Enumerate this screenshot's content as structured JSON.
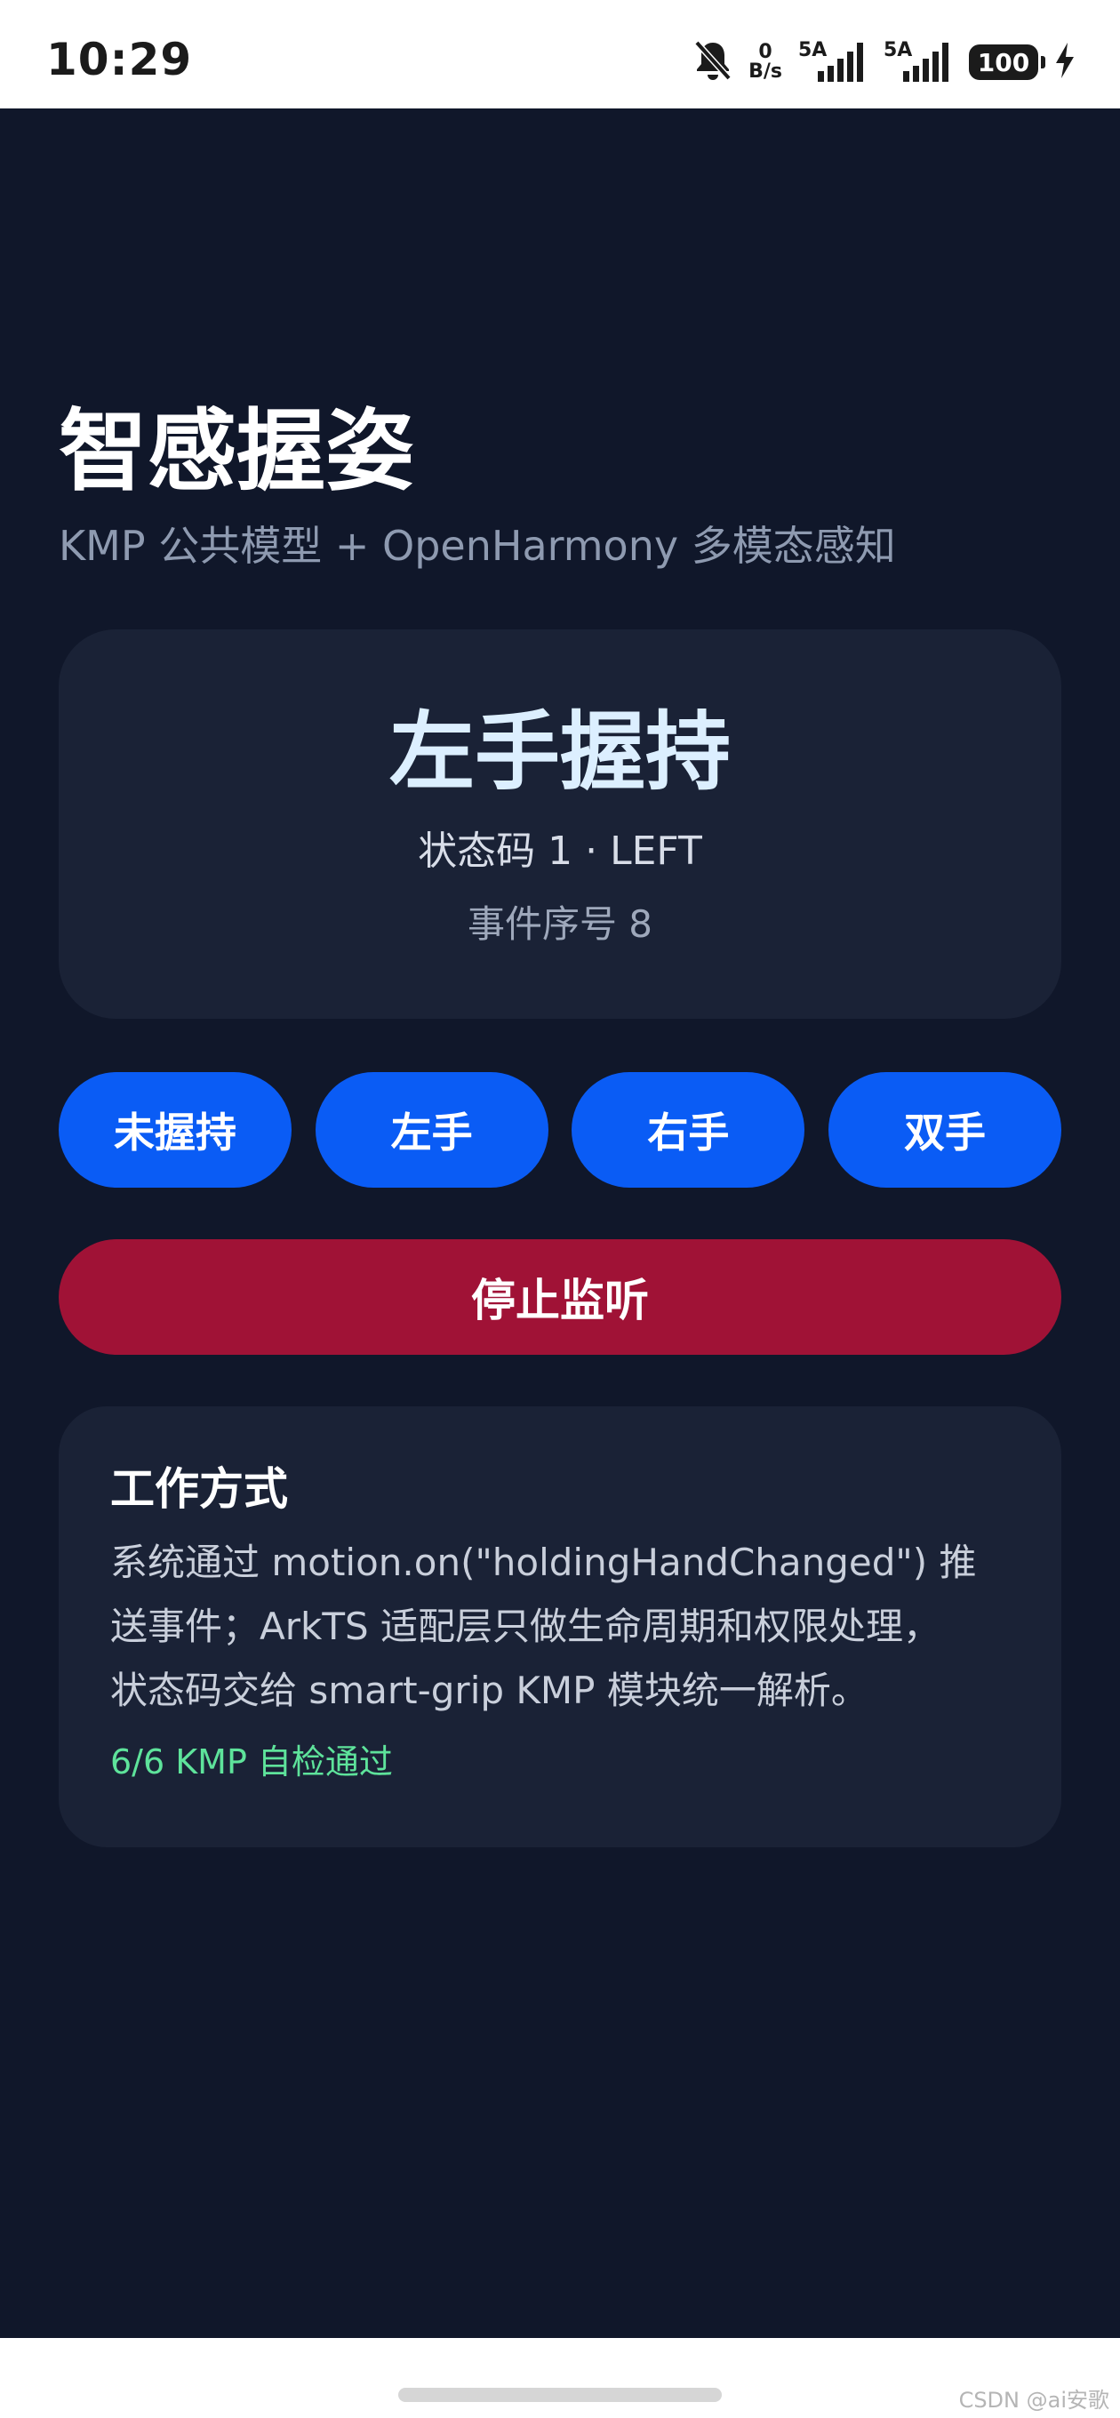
{
  "status_bar": {
    "time": "10:29",
    "net_speed_value": "0",
    "net_speed_unit": "B/s",
    "signal1_label": "5A",
    "signal2_label": "5A",
    "battery": "100"
  },
  "app": {
    "title": "智感握姿",
    "subtitle": "KMP 公共模型 + OpenHarmony 多模态感知",
    "state": {
      "main": "左手握持",
      "code": "状态码 1 · LEFT",
      "sequence": "事件序号 8"
    },
    "modes": [
      {
        "label": "未握持"
      },
      {
        "label": "左手"
      },
      {
        "label": "右手"
      },
      {
        "label": "双手"
      }
    ],
    "stop_label": "停止监听",
    "info": {
      "heading": "工作方式",
      "lines": [
        "系统通过 motion.on(\"holdingHandChanged\") 推",
        "送事件；ArkTS 适配层只做生命周期和权限处理，",
        "状态码交给 smart-grip KMP 模块统一解析。"
      ],
      "check": "6/6 KMP 自检通过"
    }
  },
  "watermark": "CSDN @ai安歌",
  "colors": {
    "background": "#10172a",
    "card": "#1a2236",
    "primary": "#0a5cf5",
    "danger": "#a01236",
    "success": "#5ee39b"
  }
}
